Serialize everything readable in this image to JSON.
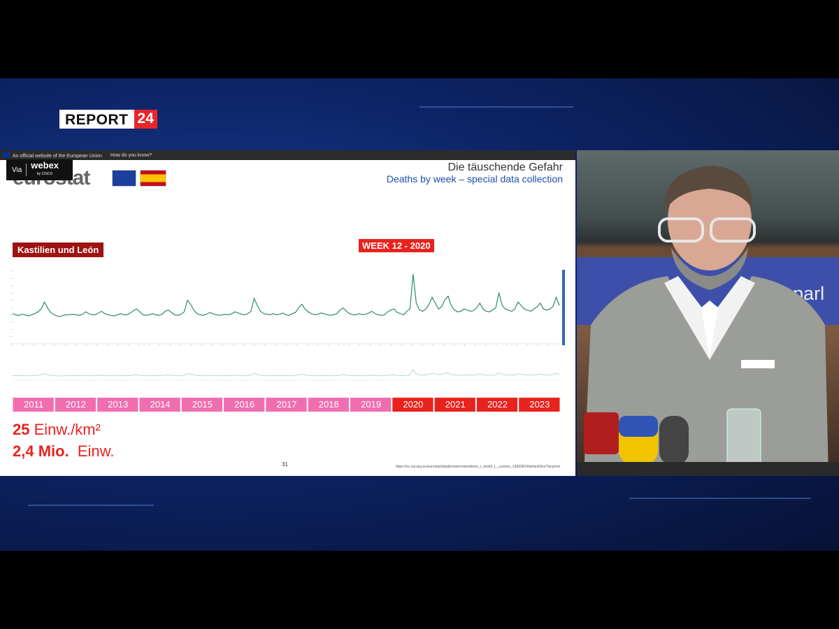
{
  "brand": {
    "logo_left": "REPORT",
    "logo_right": "24"
  },
  "eu_bar": {
    "official": "An official website of the European Union",
    "how": "How do you know?"
  },
  "webex": {
    "via": "Via",
    "name": "webex",
    "by": "by CISCO"
  },
  "slide": {
    "source_logo": "eurostat",
    "title": "Die täuschende Gefahr",
    "subtitle": "Deaths by week – special data collection",
    "region": "Kastilien und León",
    "highlight": "WEEK 12 - 2020",
    "stat1_num": "25",
    "stat1_unit": "Einw./km²",
    "stat2_num": "2,4 Mio.",
    "stat2_unit": "Einw.",
    "page": "31",
    "source_url": "https://ec.europa.eu/eurostat/databrowser/view/demo_r_mwk3_t__custom_13683824/default/line?lang=en"
  },
  "video": {
    "backdrop_text": "europarl"
  },
  "colors": {
    "line": "#2e8b6e",
    "pre_year": "#f06eb0",
    "post_year": "#e8231e",
    "accent_bar": "#3467b0"
  },
  "chart_data": {
    "type": "line",
    "title": "Deaths by week – special data collection",
    "xlabel": "",
    "ylabel": "",
    "years": [
      "2011",
      "2012",
      "2013",
      "2014",
      "2015",
      "2016",
      "2017",
      "2018",
      "2019",
      "2020",
      "2021",
      "2022",
      "2023"
    ],
    "highlight_years": [
      "2020",
      "2021",
      "2022",
      "2023"
    ],
    "series": [
      {
        "values": [
          0.52,
          0.5,
          0.49,
          0.51,
          0.5,
          0.48,
          0.5,
          0.52,
          0.55,
          0.6,
          0.72,
          0.62,
          0.54,
          0.5,
          0.48,
          0.47,
          0.49,
          0.5,
          0.5,
          0.51,
          0.5,
          0.49,
          0.51,
          0.55,
          0.52,
          0.5,
          0.5,
          0.53,
          0.56,
          0.52,
          0.5,
          0.49,
          0.48,
          0.5,
          0.52,
          0.5,
          0.5,
          0.53,
          0.57,
          0.6,
          0.55,
          0.5,
          0.49,
          0.5,
          0.52,
          0.5,
          0.49,
          0.51,
          0.56,
          0.58,
          0.54,
          0.5,
          0.49,
          0.51,
          0.55,
          0.75,
          0.68,
          0.58,
          0.52,
          0.5,
          0.49,
          0.51,
          0.54,
          0.52,
          0.5,
          0.49,
          0.5,
          0.51,
          0.5,
          0.52,
          0.55,
          0.53,
          0.51,
          0.5,
          0.52,
          0.56,
          0.78,
          0.66,
          0.56,
          0.52,
          0.51,
          0.5,
          0.52,
          0.5,
          0.51,
          0.53,
          0.5,
          0.49,
          0.52,
          0.54,
          0.62,
          0.68,
          0.6,
          0.55,
          0.52,
          0.5,
          0.51,
          0.53,
          0.52,
          0.5,
          0.49,
          0.5,
          0.52,
          0.58,
          0.62,
          0.56,
          0.52,
          0.5,
          0.5,
          0.52,
          0.5,
          0.51,
          0.53,
          0.56,
          0.52,
          0.5,
          0.49,
          0.5,
          0.55,
          0.58,
          0.6,
          0.54,
          0.52,
          0.5,
          0.56,
          0.6,
          1.2,
          0.7,
          0.58,
          0.56,
          0.6,
          0.68,
          0.8,
          0.7,
          0.6,
          0.64,
          0.76,
          0.82,
          0.66,
          0.58,
          0.55,
          0.56,
          0.6,
          0.58,
          0.56,
          0.57,
          0.62,
          0.7,
          0.6,
          0.56,
          0.55,
          0.58,
          0.62,
          0.88,
          0.66,
          0.6,
          0.58,
          0.56,
          0.6,
          0.72,
          0.66,
          0.6,
          0.58,
          0.56,
          0.6,
          0.64,
          0.7,
          0.6,
          0.58,
          0.6,
          0.64,
          0.8,
          0.66
        ]
      }
    ],
    "highlight_point": {
      "label": "WEEK 12 - 2020",
      "year": "2020",
      "week": 12
    },
    "grid": false,
    "legend": "none"
  }
}
